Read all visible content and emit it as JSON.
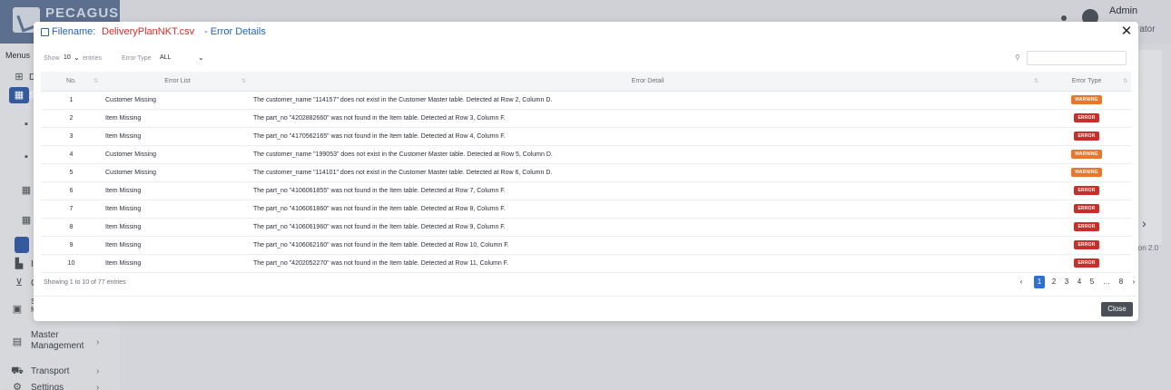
{
  "app": {
    "brand": "PECAGUS",
    "admin_name": "Admin",
    "admin_role": "rator",
    "menus_label": "Menus",
    "version_text": "ion 2.0"
  },
  "sidebar": {
    "items": [
      {
        "label": "D",
        "icon": "grid-icon"
      },
      {
        "label": "S",
        "icon": "calendar-icon"
      },
      {
        "label": "",
        "icon": "file-icon"
      },
      {
        "label": "",
        "icon": "file-icon"
      },
      {
        "label": "",
        "icon": "calendar-icon"
      },
      {
        "label": "",
        "icon": "calendar-icon"
      },
      {
        "label": "",
        "icon": "file-icon"
      },
      {
        "label": "I",
        "icon": "boxes-icon"
      },
      {
        "label": "C",
        "icon": "cart-icon"
      },
      {
        "label": "S M",
        "icon": "building-icon"
      },
      {
        "label": "Master Management",
        "icon": "database-icon"
      },
      {
        "label": "Transport",
        "icon": "truck-icon"
      },
      {
        "label": "Settings",
        "icon": "gear-icon"
      }
    ]
  },
  "modal": {
    "title_prefix": "Filename:",
    "filename": "DeliveryPlanNKT.csv",
    "title_suffix": "- Error Details",
    "controls": {
      "show_label": "Show",
      "entries_value": "10",
      "entries_label": "entries",
      "error_type_label": "Error Type",
      "error_type_value": "ALL",
      "search_placeholder": ""
    },
    "columns": [
      "No.",
      "Error List",
      "Error Detail",
      "Error Type"
    ],
    "rows": [
      {
        "no": "1",
        "list": "Customer Missing",
        "detail": "The customer_name \"114157\" does not exist in the Customer Master table. Detected at Row 2, Column D.",
        "type": "WARNING"
      },
      {
        "no": "2",
        "list": "Item Missing",
        "detail": "The part_no \"4202882660\" was not found in the Item table. Detected at Row 3, Column F.",
        "type": "ERROR"
      },
      {
        "no": "3",
        "list": "Item Missing",
        "detail": "The part_no \"4170562165\" was not found in the Item table. Detected at Row 4, Column F.",
        "type": "ERROR"
      },
      {
        "no": "4",
        "list": "Customer Missing",
        "detail": "The customer_name \"199053\" does not exist in the Customer Master table. Detected at Row 5, Column D.",
        "type": "WARNING"
      },
      {
        "no": "5",
        "list": "Customer Missing",
        "detail": "The customer_name \"114101\" does not exist in the Customer Master table. Detected at Row 6, Column D.",
        "type": "WARNING"
      },
      {
        "no": "6",
        "list": "Item Missing",
        "detail": "The part_no \"4106061855\" was not found in the Item table. Detected at Row 7, Column F.",
        "type": "ERROR"
      },
      {
        "no": "7",
        "list": "Item Missing",
        "detail": "The part_no \"4106061860\" was not found in the Item table. Detected at Row 8, Column F.",
        "type": "ERROR"
      },
      {
        "no": "8",
        "list": "Item Missing",
        "detail": "The part_no \"4106061960\" was not found in the Item table. Detected at Row 9, Column F.",
        "type": "ERROR"
      },
      {
        "no": "9",
        "list": "Item Missing",
        "detail": "The part_no \"4106062160\" was not found in the Item table. Detected at Row 10, Column F.",
        "type": "ERROR"
      },
      {
        "no": "10",
        "list": "Item Missing",
        "detail": "The part_no \"4202052270\" was not found in the Item table. Detected at Row 11, Column F.",
        "type": "ERROR"
      }
    ],
    "footer_info": "Showing 1 to 10 of 77 entries",
    "pagination": [
      "‹",
      "1",
      "2",
      "3",
      "4",
      "5",
      "…",
      "8",
      "›"
    ],
    "active_page": "1",
    "close_button": "Close"
  },
  "colors": {
    "accent": "#2563b5",
    "filename": "#c9302c",
    "warning": "#e8762c",
    "error": "#c72f2a"
  }
}
